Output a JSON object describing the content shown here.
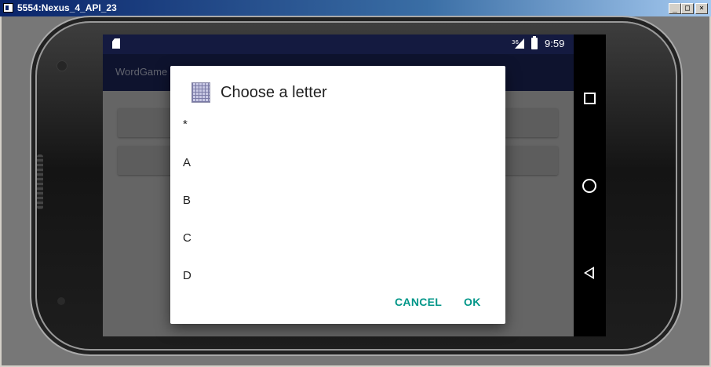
{
  "window": {
    "title": "5554:Nexus_4_API_23",
    "controls": [
      "minimize",
      "maximize",
      "close"
    ]
  },
  "status_bar": {
    "network_label": "36",
    "time": "9:59",
    "icons": [
      "sd-card-icon",
      "signal-icon",
      "battery-icon"
    ]
  },
  "app_bar": {
    "title": "WordGame"
  },
  "dialog": {
    "title": "Choose a letter",
    "icon": "letter-grid-icon",
    "items": [
      "*",
      "A",
      "B",
      "C",
      "D"
    ],
    "cancel_label": "CANCEL",
    "ok_label": "OK",
    "accent_color": "#009688"
  },
  "nav_bar": {
    "icons": [
      "recents-icon",
      "home-icon",
      "back-icon"
    ]
  },
  "colors": {
    "status_bar": "#141a40",
    "app_bar": "#1a2355",
    "dialog_bg": "#ffffff"
  }
}
